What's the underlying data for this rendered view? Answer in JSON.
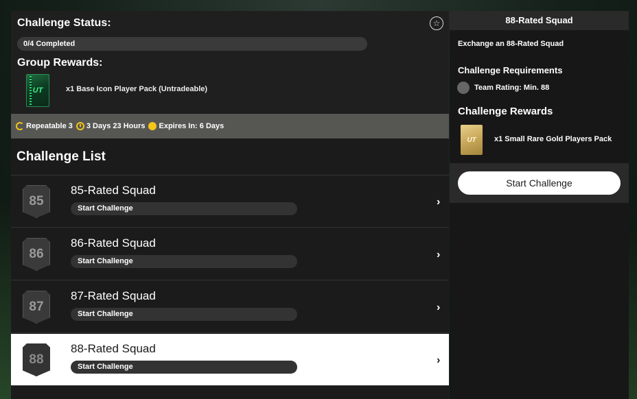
{
  "status": {
    "title": "Challenge Status:",
    "progress_text": "0/4 Completed",
    "progress_fraction": 0,
    "group_rewards_title": "Group Rewards:",
    "group_reward_text": "x1 Base Icon Player Pack (Untradeable)",
    "pack_label": "UT",
    "star_icon": "star-icon"
  },
  "info_strip": {
    "repeatable": "Repeatable 3",
    "repeat_time": "3 Days 23 Hours",
    "expires": "Expires In: 6 Days",
    "accent_color": "#f5c518"
  },
  "list": {
    "title": "Challenge List",
    "rows": [
      {
        "rating": "85",
        "title": "85-Rated Squad",
        "pill": "Start Challenge"
      },
      {
        "rating": "86",
        "title": "86-Rated Squad",
        "pill": "Start Challenge"
      },
      {
        "rating": "87",
        "title": "87-Rated Squad",
        "pill": "Start Challenge"
      },
      {
        "rating": "88",
        "title": "88-Rated Squad",
        "pill": "Start Challenge"
      }
    ],
    "selected_index": 3
  },
  "detail": {
    "header": "88-Rated Squad",
    "description": "Exchange an 88-Rated Squad",
    "requirements_title": "Challenge Requirements",
    "requirement": "Team Rating: Min. 88",
    "rewards_title": "Challenge Rewards",
    "reward_text": "x1 Small Rare Gold Players Pack",
    "pack_label": "UT",
    "start_button": "Start Challenge"
  }
}
